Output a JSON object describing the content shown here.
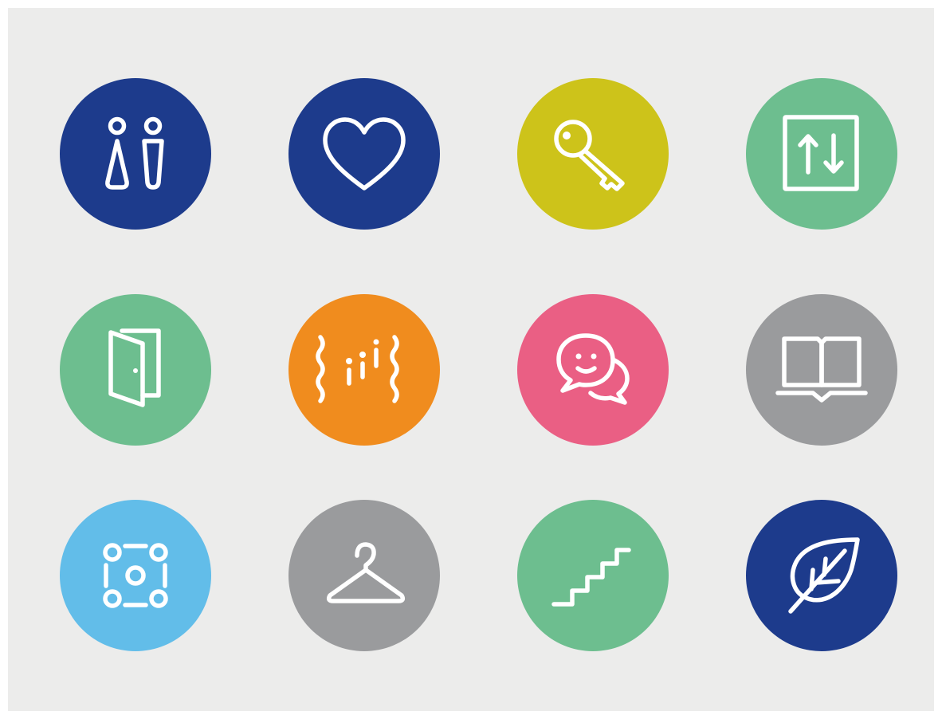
{
  "colors": {
    "background": "#ececeb",
    "navy": "#1d3b8c",
    "yellow": "#cdc31a",
    "green": "#6dbe8f",
    "orange": "#f08c1e",
    "pink": "#ea5f84",
    "gray": "#9a9b9d",
    "light_blue": "#62bde9",
    "icon": "#ffffff"
  },
  "icons": [
    {
      "name": "restroom-icon",
      "color": "navy"
    },
    {
      "name": "heart-icon",
      "color": "navy"
    },
    {
      "name": "key-icon",
      "color": "yellow"
    },
    {
      "name": "elevator-icon",
      "color": "green"
    },
    {
      "name": "door-icon",
      "color": "green"
    },
    {
      "name": "hall-people-icon",
      "color": "orange"
    },
    {
      "name": "chat-bubbles-icon",
      "color": "pink"
    },
    {
      "name": "book-icon",
      "color": "gray"
    },
    {
      "name": "group-circle-icon",
      "color": "light_blue"
    },
    {
      "name": "hanger-icon",
      "color": "gray"
    },
    {
      "name": "stairs-icon",
      "color": "green"
    },
    {
      "name": "leaf-icon",
      "color": "navy"
    }
  ]
}
